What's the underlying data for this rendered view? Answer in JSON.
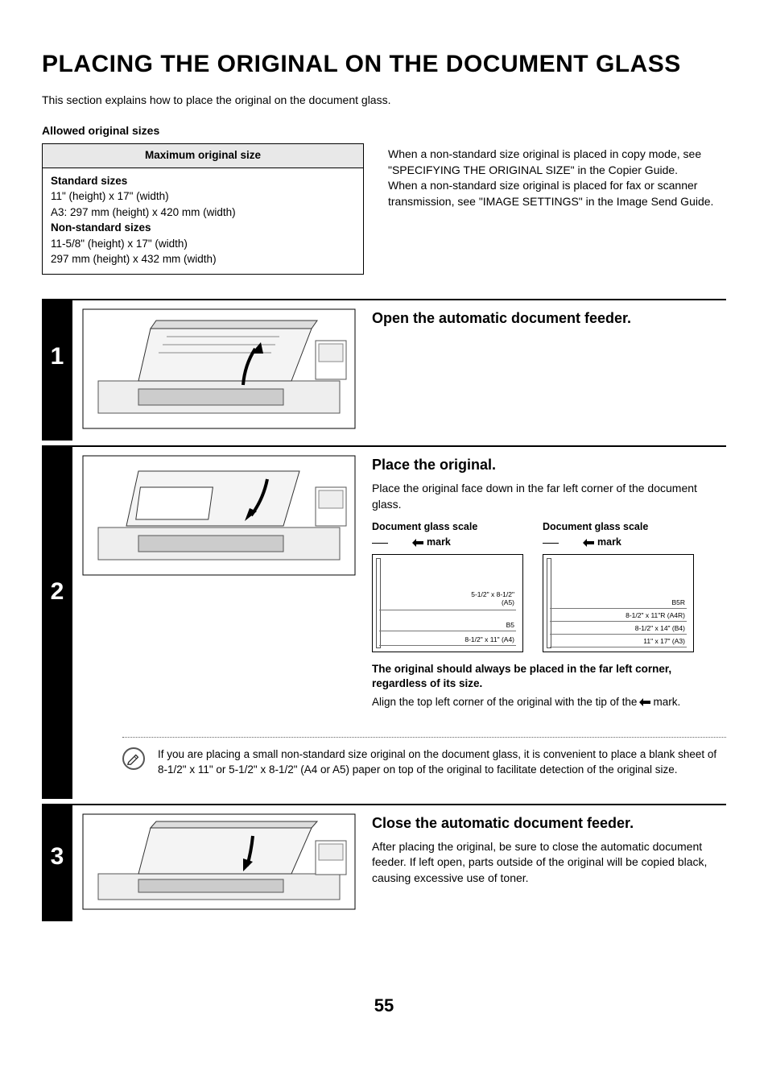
{
  "title": "PLACING THE ORIGINAL ON THE DOCUMENT GLASS",
  "intro": "This section explains how to place the original on the document glass.",
  "allowed_heading": "Allowed original sizes",
  "size_table": {
    "header": "Maximum original size",
    "std_label": "Standard sizes",
    "std_1": "11\" (height) x 17\" (width)",
    "std_2": "A3: 297 mm (height) x 420 mm (width)",
    "nonstd_label": "Non-standard sizes",
    "nonstd_1": "11-5/8\" (height) x 17\" (width)",
    "nonstd_2": "297 mm (height) x 432 mm (width)"
  },
  "right_note_1": "When a non-standard size original is placed in copy mode, see \"SPECIFYING THE ORIGINAL SIZE\" in the Copier Guide.",
  "right_note_2": "When a non-standard size original is placed for fax or scanner transmission, see \"IMAGE SETTINGS\" in the Image Send Guide.",
  "step1": {
    "num": "1",
    "heading": "Open the automatic document feeder."
  },
  "step2": {
    "num": "2",
    "heading": "Place the original.",
    "text": "Place the original face down in the far left corner of the document glass.",
    "scale_title": "Document glass scale",
    "mark_label": "mark",
    "left_diag": {
      "l1": "5-1/2\" x 8-1/2\"",
      "l1b": "(A5)",
      "l2": "B5",
      "l3": "8-1/2\" x 11\" (A4)"
    },
    "right_diag": {
      "l1": "B5R",
      "l2": "8-1/2\" x 11\"R (A4R)",
      "l3": "8-1/2\" x 14\" (B4)",
      "l4": "11\" x 17\" (A3)"
    },
    "bold_note": "The original should always be placed in the far left corner, regardless of its size.",
    "align_note_a": "Align the top left corner of the original with the tip of the",
    "align_note_b": "mark."
  },
  "tip": "If you are placing a small non-standard size original on the document glass, it is convenient to place a blank sheet of 8-1/2\" x 11\" or 5-1/2\" x 8-1/2\" (A4 or A5) paper on top of the original to facilitate detection of the original size.",
  "step3": {
    "num": "3",
    "heading": "Close the automatic document feeder.",
    "text": "After placing the original, be sure to close the automatic document feeder. If left open, parts outside of the original will be copied black, causing excessive use of toner."
  },
  "page_number": "55"
}
